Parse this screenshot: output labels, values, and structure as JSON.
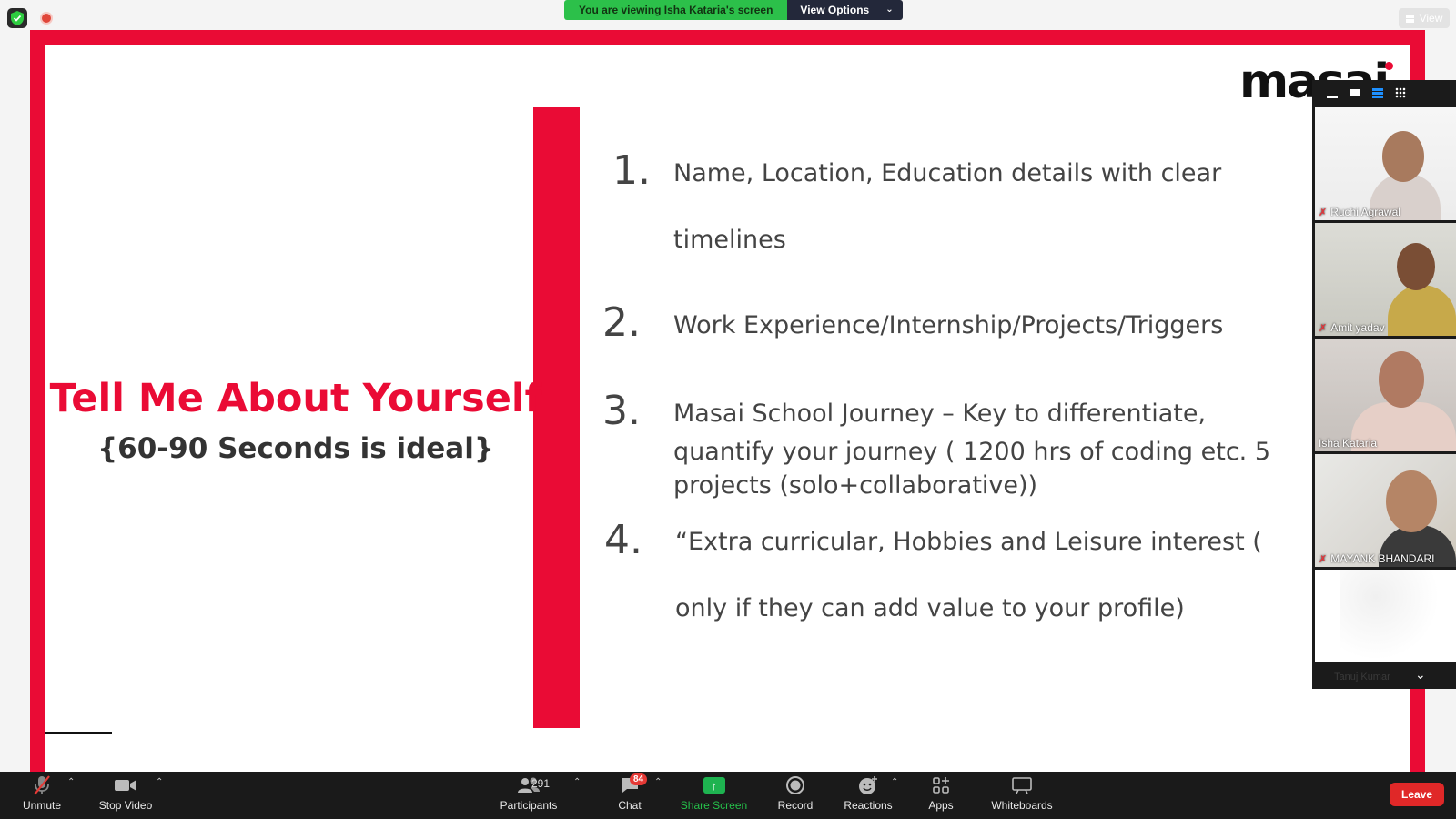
{
  "top": {
    "viewing_label": "You are viewing Isha Kataria's screen",
    "view_options_label": "View Options",
    "view_button_label": "View"
  },
  "slide": {
    "logo_text": "masai",
    "title": "Tell Me About Yourself",
    "subtitle": "{60-90 Seconds is ideal}",
    "items": [
      {
        "number": "1.",
        "lines": [
          "Name, Location, Education details with clear",
          "timelines"
        ]
      },
      {
        "number": "2.",
        "lines": [
          "Work Experience/Internship/Projects/Triggers"
        ]
      },
      {
        "number": "3.",
        "lines": [
          "Masai School Journey  – Key to differentiate,",
          "quantify your journey ( 1200 hrs of coding etc. 5",
          "projects (solo+collaborative))"
        ]
      },
      {
        "number": "4.",
        "lines": [
          "“Extra curricular, Hobbies and Leisure interest (",
          "only if they can add value to your profile)"
        ]
      }
    ],
    "accent_color": "#ea0b35"
  },
  "gallery": {
    "participants": [
      {
        "name": "Ruchi Agrawal",
        "muted": true
      },
      {
        "name": "Amit yadav",
        "muted": true
      },
      {
        "name": "Isha Kataria",
        "muted": false
      },
      {
        "name": "MAYANK BHANDARI",
        "muted": true
      },
      {
        "name": "Tanuj Kumar",
        "muted": true
      }
    ]
  },
  "toolbar": {
    "unmute_label": "Unmute",
    "stop_video_label": "Stop Video",
    "participants_label": "Participants",
    "participants_count": "291",
    "chat_label": "Chat",
    "chat_badge": "84",
    "share_label": "Share Screen",
    "record_label": "Record",
    "reactions_label": "Reactions",
    "apps_label": "Apps",
    "whiteboards_label": "Whiteboards",
    "leave_label": "Leave"
  }
}
